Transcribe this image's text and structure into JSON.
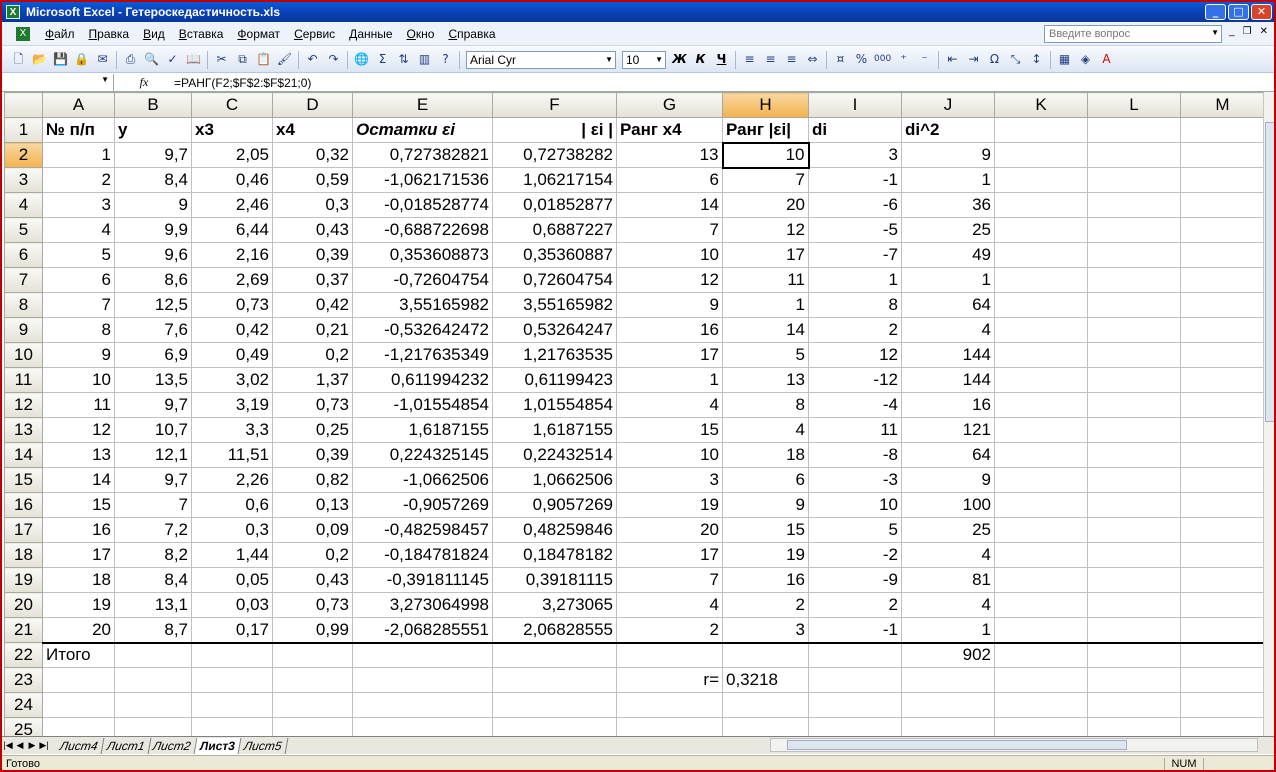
{
  "window": {
    "title": "Microsoft Excel - Гетероскедастичность.xls"
  },
  "menu": {
    "items": [
      {
        "label": "Файл",
        "u": "Ф",
        "rest": "айл"
      },
      {
        "label": "Правка",
        "u": "П",
        "rest": "равка"
      },
      {
        "label": "Вид",
        "u": "В",
        "rest": "ид"
      },
      {
        "label": "Вставка",
        "u": "В",
        "rest": "ставка"
      },
      {
        "label": "Формат",
        "u": "Ф",
        "rest": "ормат"
      },
      {
        "label": "Сервис",
        "u": "С",
        "rest": "ервис"
      },
      {
        "label": "Данные",
        "u": "Д",
        "rest": "анные"
      },
      {
        "label": "Окно",
        "u": "О",
        "rest": "кно"
      },
      {
        "label": "Справка",
        "u": "С",
        "rest": "правка"
      }
    ],
    "ask_placeholder": "Введите вопрос"
  },
  "toolbar": {
    "font": "Arial Cyr",
    "size": "10",
    "bold": "Ж",
    "italic": "К",
    "underline": "Ч",
    "percent": "%",
    "thousands": "000"
  },
  "formula_bar": {
    "cell_ref": "",
    "fx": "fx",
    "formula": "=РАНГ(F2;$F$2:$F$21;0)"
  },
  "columns": [
    "A",
    "B",
    "C",
    "D",
    "E",
    "F",
    "G",
    "H",
    "I",
    "J",
    "K",
    "L",
    "M"
  ],
  "selected_column": "H",
  "headers": [
    "№ п/п",
    "y",
    "x3",
    "x4",
    "Остатки εi",
    "| εi |",
    "Ранг x4",
    "Ранг |εi|",
    "di",
    "di^2"
  ],
  "rows": [
    [
      "1",
      "9,7",
      "2,05",
      "0,32",
      "0,727382821",
      "0,72738282",
      "13",
      "10",
      "3",
      "9"
    ],
    [
      "2",
      "8,4",
      "0,46",
      "0,59",
      "-1,062171536",
      "1,06217154",
      "6",
      "7",
      "-1",
      "1"
    ],
    [
      "3",
      "9",
      "2,46",
      "0,3",
      "-0,018528774",
      "0,01852877",
      "14",
      "20",
      "-6",
      "36"
    ],
    [
      "4",
      "9,9",
      "6,44",
      "0,43",
      "-0,688722698",
      "0,6887227",
      "7",
      "12",
      "-5",
      "25"
    ],
    [
      "5",
      "9,6",
      "2,16",
      "0,39",
      "0,353608873",
      "0,35360887",
      "10",
      "17",
      "-7",
      "49"
    ],
    [
      "6",
      "8,6",
      "2,69",
      "0,37",
      "-0,72604754",
      "0,72604754",
      "12",
      "11",
      "1",
      "1"
    ],
    [
      "7",
      "12,5",
      "0,73",
      "0,42",
      "3,55165982",
      "3,55165982",
      "9",
      "1",
      "8",
      "64"
    ],
    [
      "8",
      "7,6",
      "0,42",
      "0,21",
      "-0,532642472",
      "0,53264247",
      "16",
      "14",
      "2",
      "4"
    ],
    [
      "9",
      "6,9",
      "0,49",
      "0,2",
      "-1,217635349",
      "1,21763535",
      "17",
      "5",
      "12",
      "144"
    ],
    [
      "10",
      "13,5",
      "3,02",
      "1,37",
      "0,611994232",
      "0,61199423",
      "1",
      "13",
      "-12",
      "144"
    ],
    [
      "11",
      "9,7",
      "3,19",
      "0,73",
      "-1,01554854",
      "1,01554854",
      "4",
      "8",
      "-4",
      "16"
    ],
    [
      "12",
      "10,7",
      "3,3",
      "0,25",
      "1,6187155",
      "1,6187155",
      "15",
      "4",
      "11",
      "121"
    ],
    [
      "13",
      "12,1",
      "11,51",
      "0,39",
      "0,224325145",
      "0,22432514",
      "10",
      "18",
      "-8",
      "64"
    ],
    [
      "14",
      "9,7",
      "2,26",
      "0,82",
      "-1,0662506",
      "1,0662506",
      "3",
      "6",
      "-3",
      "9"
    ],
    [
      "15",
      "7",
      "0,6",
      "0,13",
      "-0,9057269",
      "0,9057269",
      "19",
      "9",
      "10",
      "100"
    ],
    [
      "16",
      "7,2",
      "0,3",
      "0,09",
      "-0,482598457",
      "0,48259846",
      "20",
      "15",
      "5",
      "25"
    ],
    [
      "17",
      "8,2",
      "1,44",
      "0,2",
      "-0,184781824",
      "0,18478182",
      "17",
      "19",
      "-2",
      "4"
    ],
    [
      "18",
      "8,4",
      "0,05",
      "0,43",
      "-0,391811145",
      "0,39181115",
      "7",
      "16",
      "-9",
      "81"
    ],
    [
      "19",
      "13,1",
      "0,03",
      "0,73",
      "3,273064998",
      "3,273065",
      "4",
      "2",
      "2",
      "4"
    ],
    [
      "20",
      "8,7",
      "0,17",
      "0,99",
      "-2,068285551",
      "2,06828555",
      "2",
      "3",
      "-1",
      "1"
    ]
  ],
  "total": {
    "label": "Итого",
    "value": "902"
  },
  "r": {
    "label": "r=",
    "value": "0,3218"
  },
  "row_numbers": [
    "1",
    "2",
    "3",
    "4",
    "5",
    "6",
    "7",
    "8",
    "9",
    "10",
    "11",
    "12",
    "13",
    "14",
    "15",
    "16",
    "17",
    "18",
    "19",
    "20",
    "21",
    "22",
    "23",
    "24",
    "25"
  ],
  "sheets": [
    {
      "name": "Лист4"
    },
    {
      "name": "Лист1"
    },
    {
      "name": "Лист2"
    },
    {
      "name": "Лист3",
      "active": true
    },
    {
      "name": "Лист5"
    }
  ],
  "status": {
    "ready": "Готово",
    "num": "NUM"
  }
}
